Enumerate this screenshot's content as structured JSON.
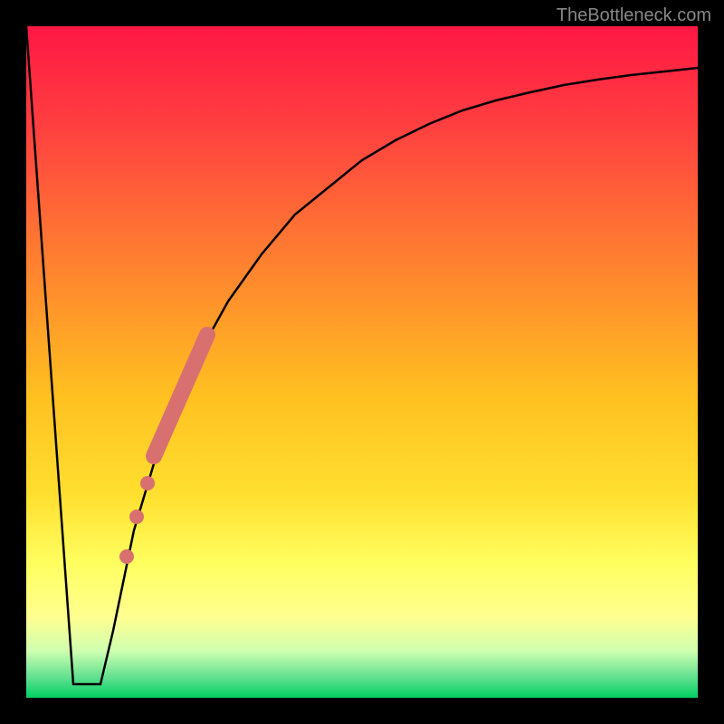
{
  "watermark": "TheBottleneck.com",
  "chart_data": {
    "type": "line",
    "title": "",
    "xlabel": "",
    "ylabel": "",
    "xlim": [
      0,
      100
    ],
    "ylim": [
      0,
      100
    ],
    "background_gradient": {
      "stops": [
        {
          "offset": 0,
          "color": "#ff1744"
        },
        {
          "offset": 15,
          "color": "#ff4040"
        },
        {
          "offset": 35,
          "color": "#ff8030"
        },
        {
          "offset": 55,
          "color": "#ffc020"
        },
        {
          "offset": 70,
          "color": "#ffe030"
        },
        {
          "offset": 80,
          "color": "#ffff60"
        },
        {
          "offset": 88,
          "color": "#ffff90"
        },
        {
          "offset": 93,
          "color": "#d0ffb0"
        },
        {
          "offset": 97,
          "color": "#60e090"
        },
        {
          "offset": 100,
          "color": "#00d060"
        }
      ]
    },
    "series": [
      {
        "name": "main-curve",
        "x": [
          0,
          7,
          9,
          11,
          13,
          16,
          20,
          25,
          30,
          35,
          40,
          45,
          50,
          55,
          60,
          65,
          70,
          75,
          80,
          85,
          90,
          95,
          100
        ],
        "y": [
          100,
          2,
          2,
          2,
          10,
          25,
          38,
          50,
          59,
          66,
          72,
          76,
          80,
          83,
          85.5,
          87.5,
          89,
          90.2,
          91.2,
          92,
          92.7,
          93.3,
          93.8
        ]
      }
    ],
    "highlighted_segments": [
      {
        "name": "main-segment",
        "type": "thick-line",
        "color": "#d87070",
        "width": 14,
        "x": [
          19,
          27
        ],
        "y": [
          36,
          54
        ]
      },
      {
        "name": "dot-1",
        "type": "dot",
        "color": "#d87070",
        "radius": 7,
        "x": 18,
        "y": 32
      },
      {
        "name": "dot-2",
        "type": "dot",
        "color": "#d87070",
        "radius": 7,
        "x": 16.5,
        "y": 27
      },
      {
        "name": "dot-3",
        "type": "dot",
        "color": "#d87070",
        "radius": 7,
        "x": 15,
        "y": 21
      }
    ]
  }
}
